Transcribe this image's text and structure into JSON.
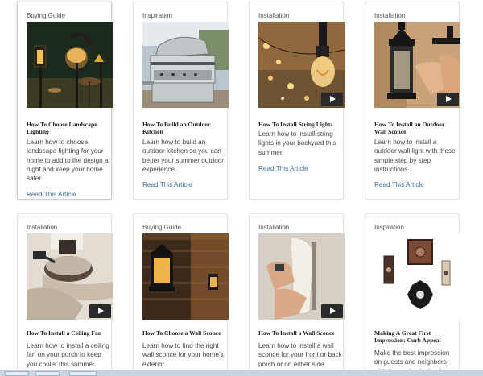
{
  "cards": [
    {
      "category": "Buying Guide",
      "title": "How To Choose Landscape Lighting",
      "description": "Learn how to choose landscape lighting for your home to add to the design at night and keep your home safer.",
      "link": "Read This Article",
      "image": "landscape-lights-image",
      "video": false
    },
    {
      "category": "Inspiration",
      "title": "How To Build an Outdoor Kitchen",
      "description": "Learn how to build an outdoor kitchen so you can better your summer outdoor experience.",
      "link": "Read This Article",
      "image": "outdoor-grill-image",
      "video": false
    },
    {
      "category": "Installation",
      "title": "How To Install String Lights",
      "description": "Learn how to install string lights in your backyard this summer.",
      "link": "Read This Article",
      "image": "string-lights-image",
      "video": true
    },
    {
      "category": "Installation",
      "title": "How To Install an Outdoor Wall Sconce",
      "description": "Learn how to install a outdoor wall light with these simple step by step instructions.",
      "link": "Read This Article",
      "image": "wall-lantern-image",
      "video": true
    },
    {
      "category": "Installation",
      "title": "How To Install a Ceiling Fan",
      "description": "Learn how to install a ceiling fan on your porch to keep you cooler this summer.",
      "link": "",
      "image": "ceiling-fan-image",
      "video": true
    },
    {
      "category": "Buying Guide",
      "title": "How To Choose a Wall Sconce",
      "description": "Learn how to find the right wall sconce for your home's exterior.",
      "link": "",
      "image": "wall-sconce-image",
      "video": false
    },
    {
      "category": "Installation",
      "title": "How To Install a Wall Sconce",
      "description": "Learn how to install a wall sconce for your front or back porch or on either side",
      "link": "",
      "image": "sconce-install-image",
      "video": true
    },
    {
      "category": "Inspiration",
      "title": "Making A Great First Impression: Curb Appeal",
      "description": "Make the best impression on guests and neighbors with these simple tips for",
      "link": "",
      "image": "doorbell-hardware-image",
      "video": false
    }
  ]
}
